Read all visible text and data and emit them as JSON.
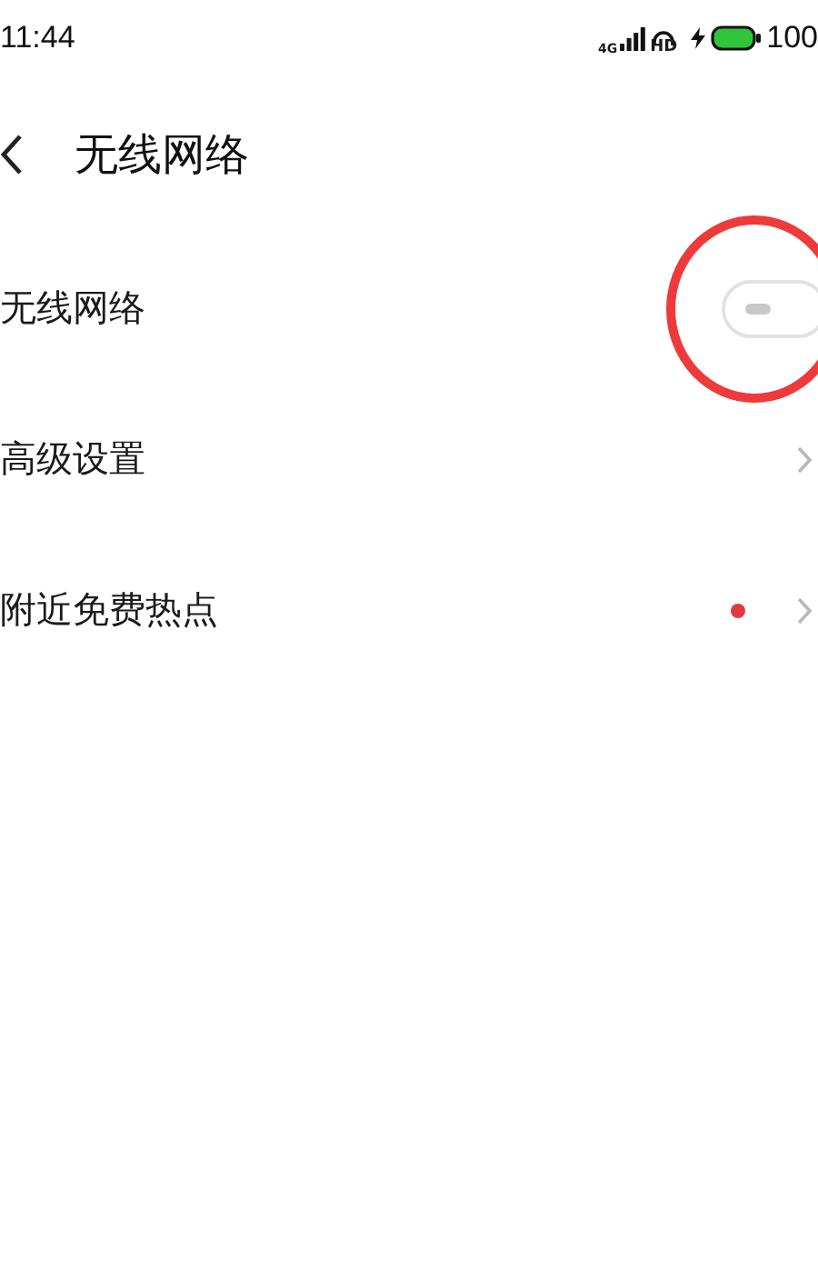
{
  "status_bar": {
    "time": "11:44",
    "network": "4G",
    "hd": "HD",
    "battery": "100"
  },
  "header": {
    "title": "无线网络"
  },
  "rows": [
    {
      "kind": "toggle",
      "label": "无线网络",
      "on": false
    },
    {
      "kind": "link",
      "label": "高级设置"
    },
    {
      "kind": "link",
      "label": "附近免费热点",
      "color": "#e0393e"
    }
  ]
}
